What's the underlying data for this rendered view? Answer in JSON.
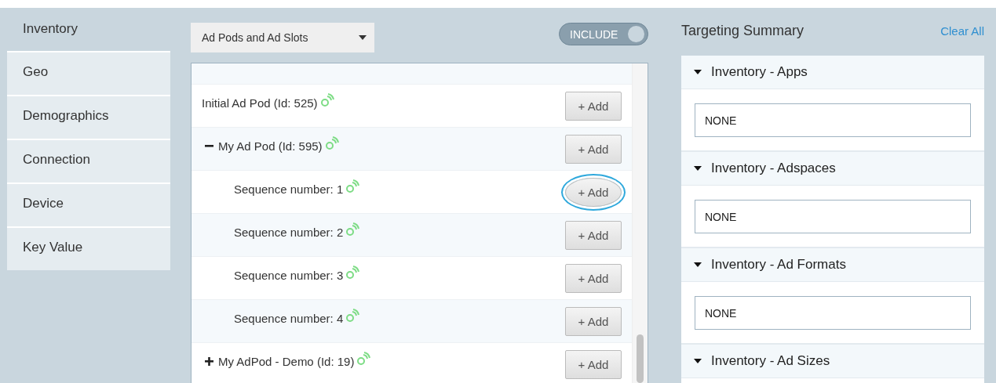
{
  "tabs": [
    {
      "label": "Inventory",
      "selected": true
    },
    {
      "label": "Geo",
      "selected": false
    },
    {
      "label": "Demographics",
      "selected": false
    },
    {
      "label": "Connection",
      "selected": false
    },
    {
      "label": "Device",
      "selected": false
    },
    {
      "label": "Key Value",
      "selected": false
    }
  ],
  "dropdown": {
    "value": "Ad Pods and Ad Slots"
  },
  "include_toggle": {
    "label": "INCLUDE",
    "on": true
  },
  "pods": [
    {
      "label": "Initial Ad Pod (Id: 525)",
      "button": "+ Add",
      "highlighted": false
    },
    {
      "label": "My Ad Pod (Id: 595)",
      "expanded": true,
      "button": "+ Add",
      "highlighted": false,
      "children": [
        {
          "label": "Sequence number: 1",
          "button": "+ Add",
          "highlighted": true
        },
        {
          "label": "Sequence number: 2",
          "button": "+ Add",
          "highlighted": false
        },
        {
          "label": "Sequence number: 3",
          "button": "+ Add",
          "highlighted": false
        },
        {
          "label": "Sequence number: 4",
          "button": "+ Add",
          "highlighted": false
        }
      ]
    },
    {
      "label": "My AdPod - Demo (Id: 19)",
      "expanded": false,
      "button": "+ Add",
      "highlighted": false
    }
  ],
  "summary": {
    "title": "Targeting Summary",
    "clear_link": "Clear All",
    "sections": [
      {
        "title": "Inventory - Apps",
        "expanded": true,
        "value": "NONE"
      },
      {
        "title": "Inventory - Adspaces",
        "expanded": true,
        "value": "NONE"
      },
      {
        "title": "Inventory - Ad Formats",
        "expanded": true,
        "value": "NONE"
      },
      {
        "title": "Inventory - Ad Sizes",
        "expanded": true
      }
    ]
  }
}
